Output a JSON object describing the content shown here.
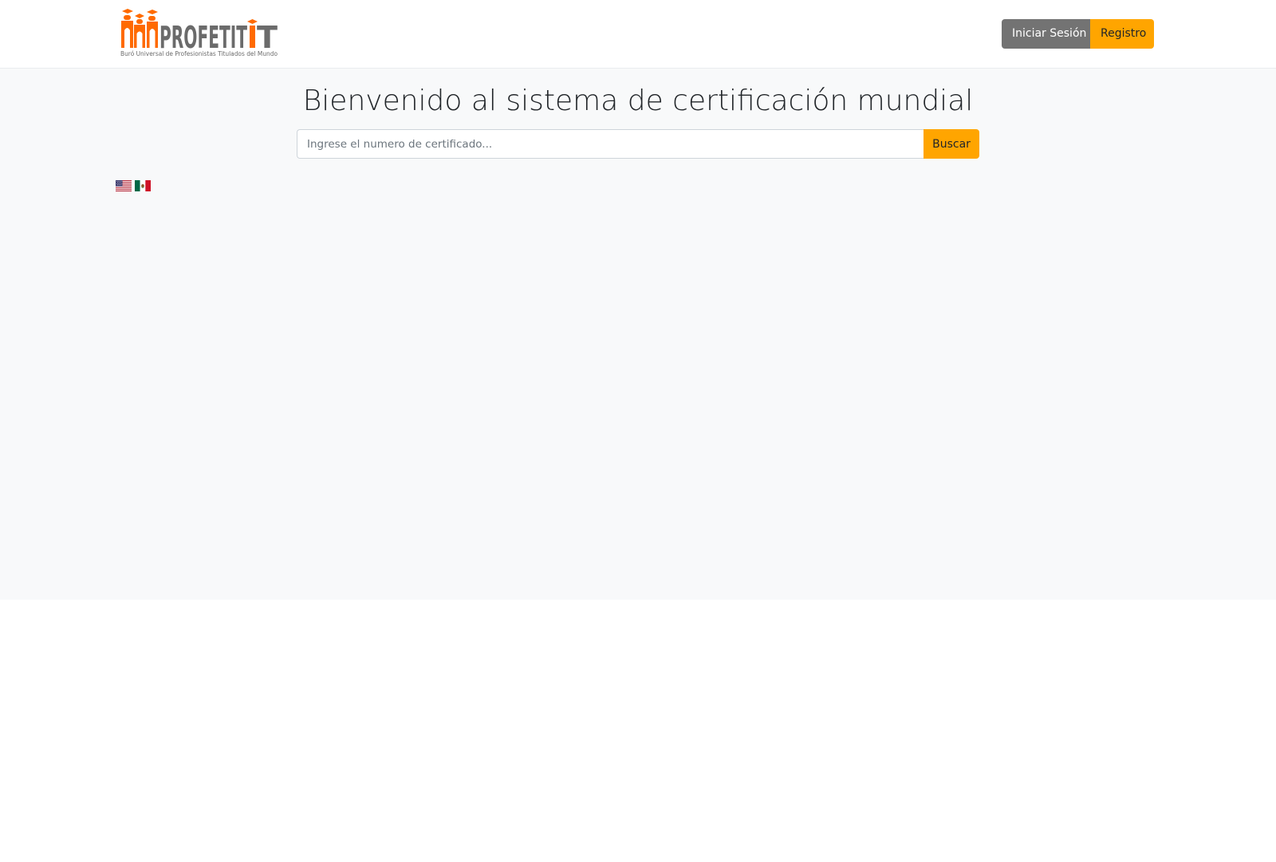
{
  "brand": {
    "name": "PROFETIT",
    "tagline": "Buró Universal de Profesionistas Titulados del Mundo",
    "colors": {
      "primary": "#ff6a00",
      "secondary": "#6b6b6b"
    }
  },
  "header": {
    "login_label": "Iniciar Sesión",
    "register_label": "Registro"
  },
  "main": {
    "title": "Bienvenido al sistema de certificación mundial",
    "search": {
      "placeholder": "Ingrese el numero de certificado...",
      "value": "",
      "button_label": "Buscar"
    },
    "languages": [
      {
        "code": "en",
        "icon": "us-flag-icon"
      },
      {
        "code": "es",
        "icon": "mexico-flag-icon"
      }
    ]
  },
  "colors": {
    "accent": "#ffa500",
    "login_button": "#737373",
    "page_bg": "#f8f9fa"
  }
}
